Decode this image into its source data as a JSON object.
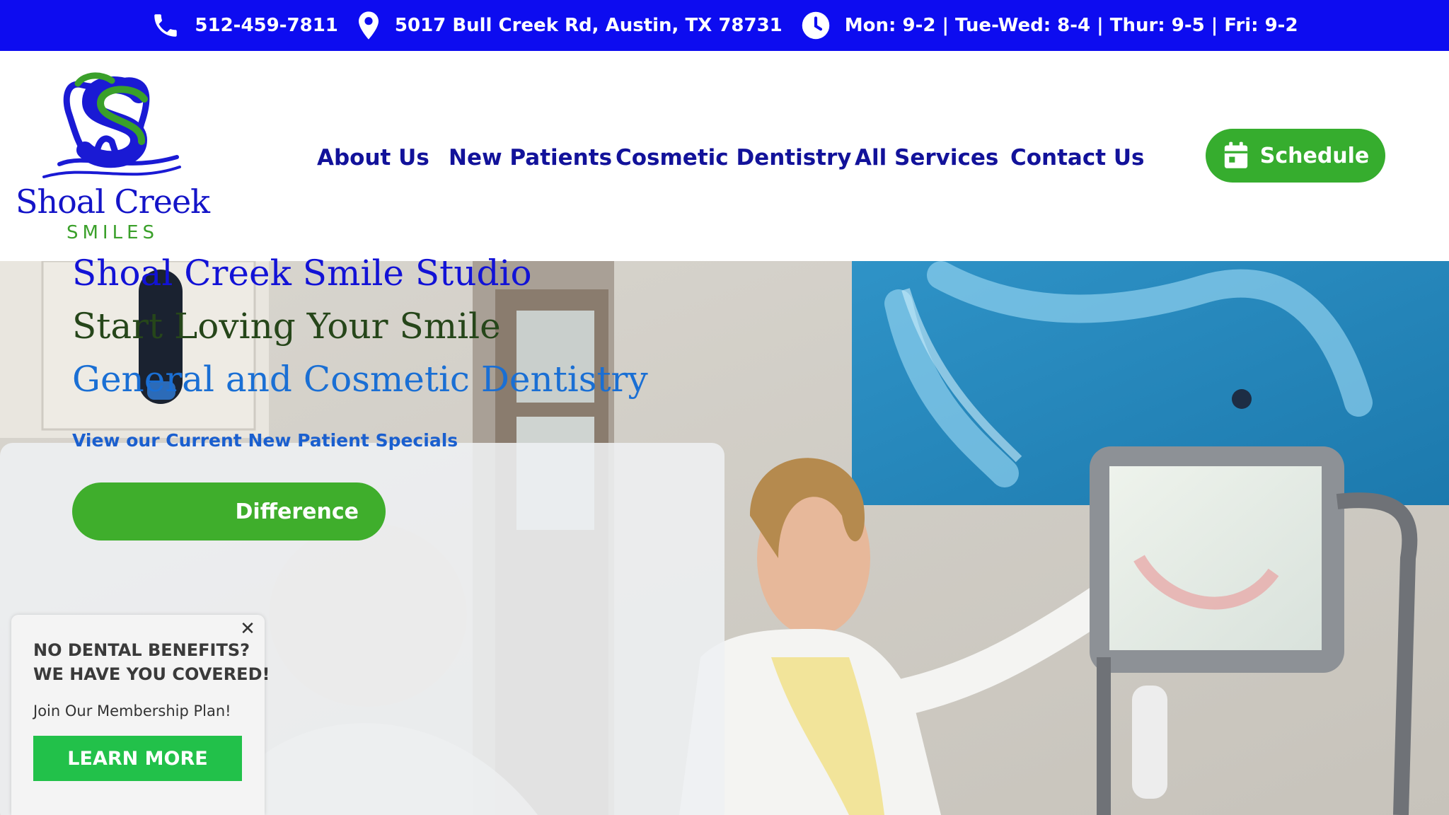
{
  "topbar": {
    "phone": "512-459-7811",
    "address": "5017 Bull Creek Rd, Austin, TX 78731",
    "hours": "Mon: 9-2 | Tue-Wed: 8-4 | Thur: 9-5 | Fri: 9-2",
    "icons": [
      "phone-icon",
      "map-pin-icon",
      "clock-icon"
    ]
  },
  "logo": {
    "name": "Shoal Creek",
    "sub": "SMILES"
  },
  "nav": {
    "items": [
      {
        "label": "About Us"
      },
      {
        "label": "New Patients"
      },
      {
        "label": "Cosmetic Dentistry"
      },
      {
        "label": "All Services"
      },
      {
        "label": "Contact Us"
      }
    ],
    "schedule_label": "Schedule"
  },
  "hero": {
    "title": "Shoal Creek Smile Studio",
    "tagline": "Start Loving Your Smile",
    "subtitle": "General and Cosmetic Dentistry",
    "specials_link": "View our Current New Patient Specials",
    "cta_label": "Difference"
  },
  "popup": {
    "heading_line1": "NO DENTAL BENEFITS?",
    "heading_line2": "WE HAVE YOU COVERED!",
    "text": "Join Our Membership Plan!",
    "button_label": "LEARN MORE",
    "close_symbol": "✕"
  },
  "colors": {
    "topbar_bg": "#0d0cf0",
    "nav_text": "#12129a",
    "brand_green": "#36ad2e",
    "brand_blue": "#1212d6",
    "popup_button": "#22c14a"
  }
}
